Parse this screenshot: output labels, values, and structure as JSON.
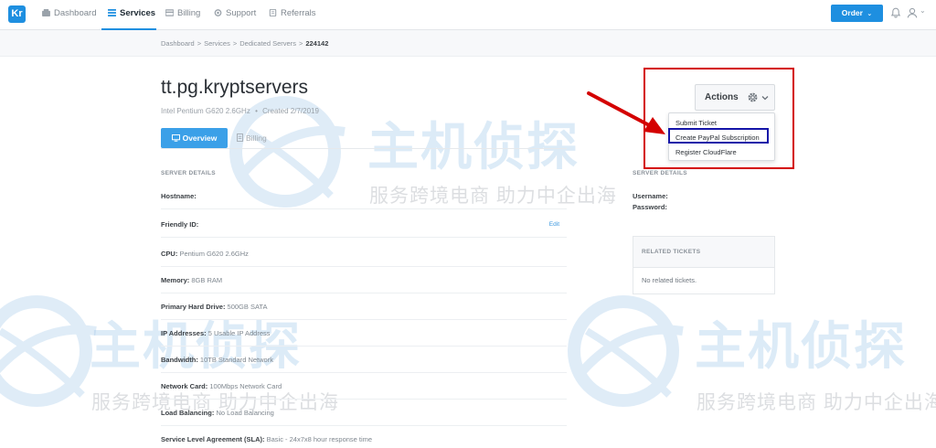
{
  "nav": {
    "logo": "Kr",
    "items": [
      {
        "label": "Dashboard",
        "icon": "dashboard-icon"
      },
      {
        "label": "Services",
        "icon": "services-icon"
      },
      {
        "label": "Billing",
        "icon": "billing-icon"
      },
      {
        "label": "Support",
        "icon": "support-icon"
      },
      {
        "label": "Referrals",
        "icon": "referrals-icon"
      }
    ],
    "active": "Services",
    "order_label": "Order"
  },
  "breadcrumb": {
    "items": [
      "Dashboard",
      "Services",
      "Dedicated Servers",
      "224142"
    ],
    "separator": ">"
  },
  "server": {
    "title": "tt.pg.kryptservers",
    "subtitle": "Intel Pentium G620 2.6GHz",
    "subtitle_sep": "•",
    "created": "Created 2/7/2019"
  },
  "tabs": [
    {
      "label": "Overview"
    },
    {
      "label": "Billing"
    }
  ],
  "details": {
    "section_title": "SERVER DETAILS",
    "rows": [
      {
        "label": "Hostname:",
        "value": ""
      },
      {
        "label": "Friendly ID:",
        "value": "",
        "action": "Edit"
      },
      {
        "label": "CPU:",
        "value": "Pentium G620 2.6GHz"
      },
      {
        "label": "Memory:",
        "value": "8GB RAM"
      },
      {
        "label": "Primary Hard Drive:",
        "value": "500GB SATA"
      },
      {
        "label": "IP Addresses:",
        "value": "5 Usable IP Address"
      },
      {
        "label": "Bandwidth:",
        "value": "10TB Standard Network"
      },
      {
        "label": "Network Card:",
        "value": "100Mbps Network Card"
      },
      {
        "label": "Load Balancing:",
        "value": "No Load Balancing"
      },
      {
        "label": "Service Level Agreement (SLA):",
        "value": "Basic - 24x7x8 hour response time"
      }
    ]
  },
  "right": {
    "section_title": "SERVER DETAILS",
    "username_label": "Username:",
    "password_label": "Password:",
    "tickets_title": "RELATED TICKETS",
    "tickets_empty": "No related tickets."
  },
  "actions": {
    "label": "Actions",
    "menu": [
      "Submit Ticket",
      "Create PayPal Subscription",
      "Register CloudFlare"
    ]
  },
  "watermark": {
    "big": "主机侦探",
    "small": "服务跨境电商 助力中企出海"
  },
  "colors": {
    "accent": "#1e8fe0",
    "annotation_red": "#d40000",
    "annotation_blue": "#1515a8"
  }
}
